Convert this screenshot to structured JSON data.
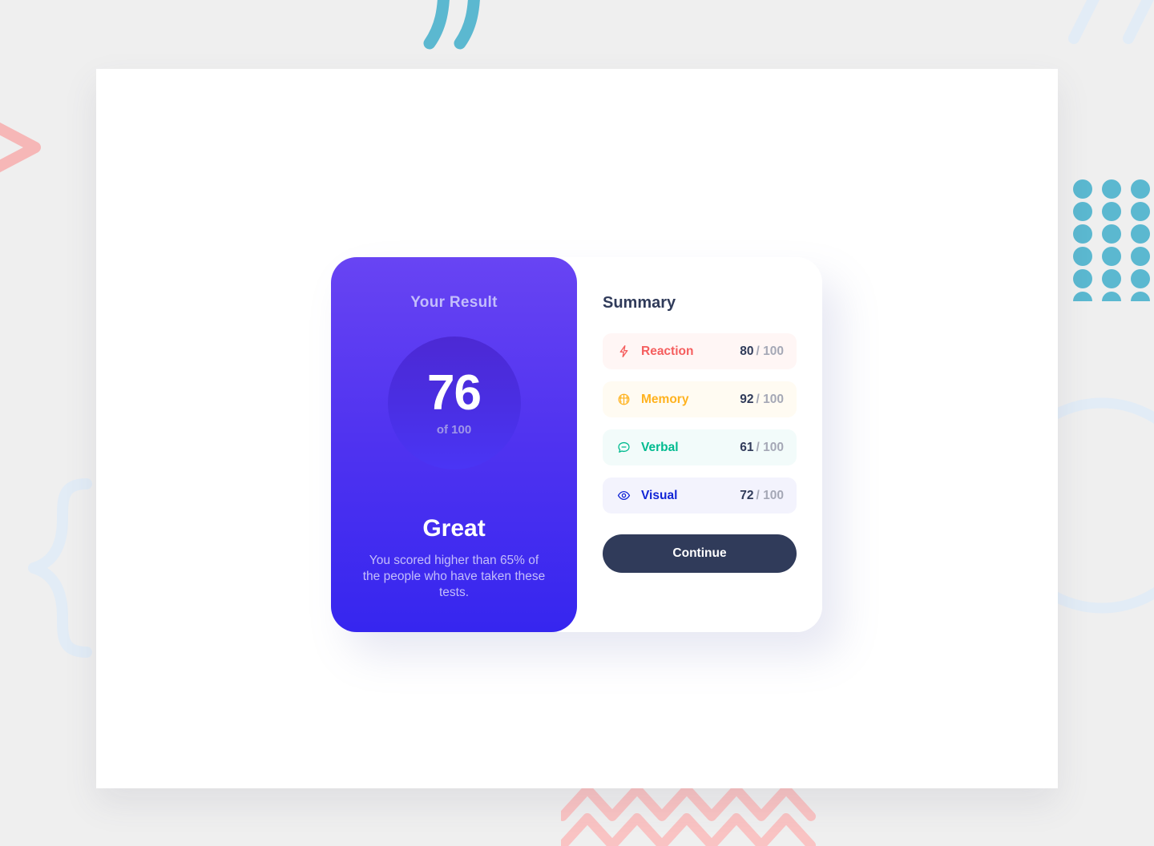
{
  "result": {
    "title": "Your Result",
    "score": "76",
    "score_total": "of 100",
    "headline": "Great",
    "description": "You scored higher than 65% of the people who have taken these tests."
  },
  "summary": {
    "title": "Summary",
    "items": [
      {
        "icon": "lightning-bolt-icon",
        "label": "Reaction",
        "score": "80",
        "total": "/ 100",
        "color": "#f55e5e",
        "background": "#fff6f5"
      },
      {
        "icon": "brain-icon",
        "label": "Memory",
        "score": "92",
        "total": "/ 100",
        "color": "#ffb21e",
        "background": "#fffbf2"
      },
      {
        "icon": "chat-bubble-icon",
        "label": "Verbal",
        "score": "61",
        "total": "/ 100",
        "color": "#00bb8f",
        "background": "#f2fbfa"
      },
      {
        "icon": "eye-icon",
        "label": "Visual",
        "score": "72",
        "total": "/ 100",
        "color": "#1125d6",
        "background": "#f3f3fd"
      }
    ],
    "continue_label": "Continue"
  },
  "decor": {
    "quote_color": "#5bb8d0",
    "dots_color": "#5bb8d0",
    "slash_color": "#e2ecf6",
    "chevron_color": "#f6b7b7",
    "brace_color": "#e2ecf6",
    "circle_color": "#e2ecf6",
    "zigzag_color": "#f9c3c3"
  }
}
